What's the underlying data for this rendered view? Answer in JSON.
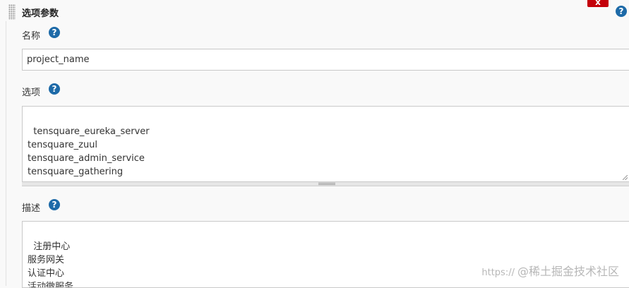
{
  "section": {
    "title": "选项参数",
    "delete_label": "x"
  },
  "help_glyph": "?",
  "fields": {
    "name": {
      "label": "名称",
      "value": "project_name"
    },
    "choices": {
      "label": "选项",
      "value": "tensquare_eureka_server\ntensquare_zuul\ntensquare_admin_service\ntensquare_gathering"
    },
    "description": {
      "label": "描述",
      "value": "注册中心\n服务网关\n认证中心\n活动微服务"
    }
  },
  "watermark": {
    "url": "https://",
    "brand": "@稀土掘金技术社区"
  },
  "colors": {
    "help_icon": "#1d6aa8",
    "delete_button": "#c4000a"
  }
}
